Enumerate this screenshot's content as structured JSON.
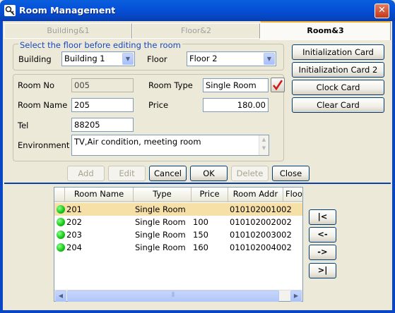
{
  "window": {
    "title": "Room Management",
    "close_glyph": "✕"
  },
  "tabs": [
    {
      "label": "Building&1"
    },
    {
      "label": "Floor&2"
    },
    {
      "label": "Room&3"
    }
  ],
  "floor_group": {
    "title": "Select the floor before editing the room",
    "building_label": "Building",
    "building_value": "Building 1",
    "floor_label": "Floor",
    "floor_value": "Floor 2"
  },
  "room_form": {
    "room_no_label": "Room No",
    "room_no_value": "005",
    "room_type_label": "Room Type",
    "room_type_value": "Single Room",
    "room_name_label": "Room Name",
    "room_name_value": "205",
    "price_label": "Price",
    "price_value": "180.00",
    "tel_label": "Tel",
    "tel_value": "88205",
    "environment_label": "Environment",
    "environment_value": "TV,Air condition, meeting room"
  },
  "card_buttons": [
    "Initialization Card",
    "Initialization Card 2",
    "Clock Card",
    "Clear Card"
  ],
  "actions": {
    "add": "Add",
    "edit": "Edit",
    "cancel": "Cancel",
    "ok": "OK",
    "delete": "Delete",
    "close": "Close"
  },
  "grid": {
    "columns": [
      "Room Name",
      "Type",
      "Price",
      "Room Addr",
      "Floo"
    ],
    "rows": [
      {
        "name": "201",
        "type": "Single Room",
        "price": "",
        "addr": "010102001002",
        "selected": true
      },
      {
        "name": "202",
        "type": "Single Room",
        "price": "100",
        "addr": "010102002002",
        "selected": false
      },
      {
        "name": "203",
        "type": "Single Room",
        "price": "150",
        "addr": "010102003002",
        "selected": false
      },
      {
        "name": "204",
        "type": "Single Room",
        "price": "160",
        "addr": "010102004002",
        "selected": false
      }
    ],
    "status_color": "#13c313",
    "selected_color": "#f7dfa8"
  },
  "nav_buttons": [
    "|<",
    "<-",
    "->",
    ">|"
  ],
  "icons": {
    "app": "key-icon",
    "room_type_pick": "checkmark-icon"
  }
}
